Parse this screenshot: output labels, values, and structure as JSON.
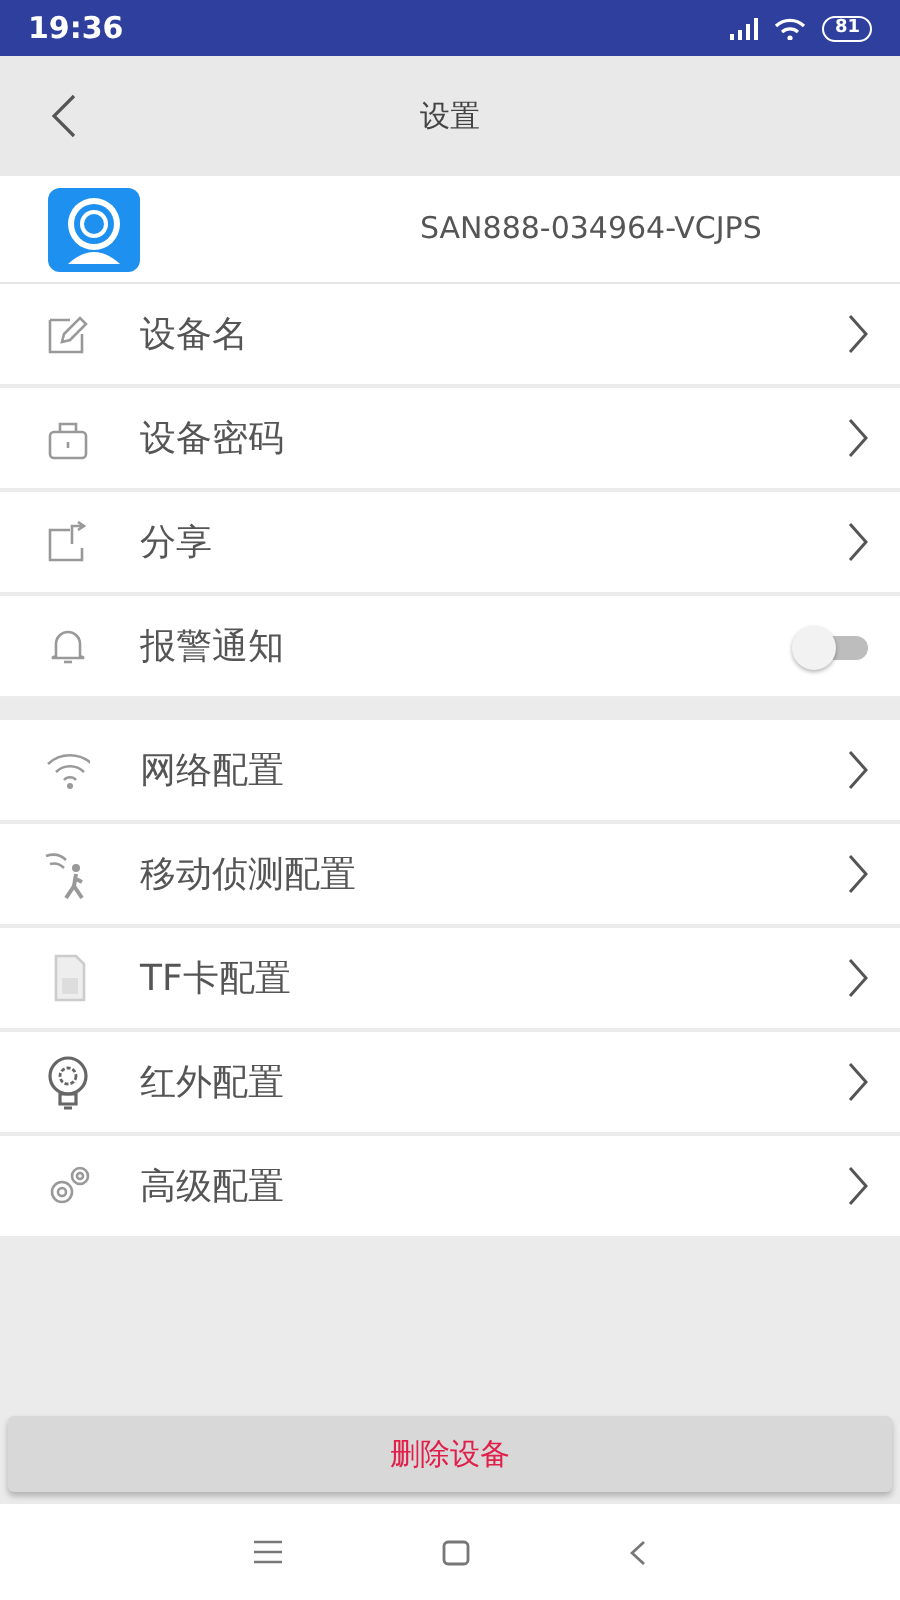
{
  "status_bar": {
    "time": "19:36",
    "battery": "81"
  },
  "header": {
    "title": "设置"
  },
  "device": {
    "id": "SAN888-034964-VCJPS"
  },
  "groups": [
    [
      {
        "kind": "link",
        "label": "设备名"
      },
      {
        "kind": "link",
        "label": "设备密码"
      },
      {
        "kind": "link",
        "label": "分享"
      },
      {
        "kind": "toggle",
        "label": "报警通知",
        "on": false
      }
    ],
    [
      {
        "kind": "link",
        "label": "网络配置"
      },
      {
        "kind": "link",
        "label": "移动侦测配置"
      },
      {
        "kind": "link",
        "label": "TF卡配置"
      },
      {
        "kind": "link",
        "label": "红外配置"
      },
      {
        "kind": "link",
        "label": "高级配置"
      }
    ]
  ],
  "delete_button": "删除设备"
}
